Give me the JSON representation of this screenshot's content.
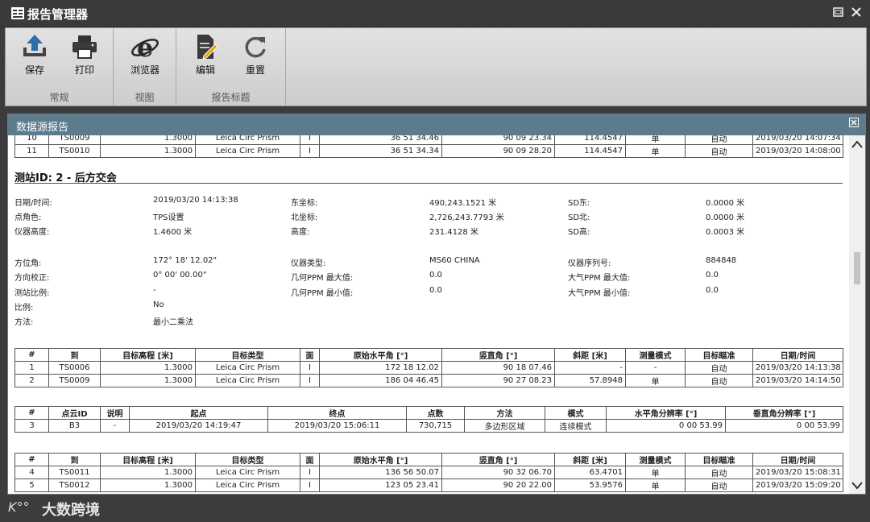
{
  "window": {
    "title": "报告管理器"
  },
  "ribbon": {
    "groups": [
      {
        "label": "常规",
        "buttons": [
          {
            "label": "保存",
            "icon": "upload-save-icon"
          },
          {
            "label": "打印",
            "icon": "printer-icon"
          }
        ]
      },
      {
        "label": "视图",
        "buttons": [
          {
            "label": "浏览器",
            "icon": "browser-e-icon"
          }
        ]
      },
      {
        "label": "报告标题",
        "buttons": [
          {
            "label": "编辑",
            "icon": "document-edit-icon"
          },
          {
            "label": "重置",
            "icon": "refresh-icon"
          }
        ]
      }
    ]
  },
  "panel": {
    "title": "数据源报告"
  },
  "top_table": {
    "rows": [
      [
        "10",
        "TS0009",
        "1.3000",
        "Leica Circ Prism",
        "I",
        "36 51 34.46",
        "90 09 23.34",
        "114.4547",
        "单",
        "自动",
        "2019/03/20 14:07:34"
      ],
      [
        "11",
        "TS0010",
        "1.3000",
        "Leica Circ Prism",
        "I",
        "36 51 34.34",
        "90 09 28.20",
        "114.4547",
        "单",
        "自动",
        "2019/03/20 14:08:00"
      ]
    ]
  },
  "station": {
    "title": "测站ID: 2 - 后方交会",
    "info_block1": {
      "col1": [
        [
          "日期/时间:",
          "2019/03/20 14:13:38"
        ],
        [
          "点角色:",
          "TPS设置"
        ],
        [
          "仪器高度:",
          "1.4600 米"
        ]
      ],
      "col2": [
        [
          "东坐标:",
          "490,243.1521 米"
        ],
        [
          "北坐标:",
          "2,726,243.7793 米"
        ],
        [
          "高度:",
          "231.4128 米"
        ]
      ],
      "col3": [
        [
          "SD东:",
          "0.0000 米"
        ],
        [
          "SD北:",
          "0.0000 米"
        ],
        [
          "SD高:",
          "0.0003 米"
        ]
      ]
    },
    "info_block2": {
      "col1": [
        [
          "方位角:",
          "172° 18' 12.02\""
        ],
        [
          "方向校正:",
          "0° 00' 00.00\""
        ],
        [
          "测站比例:",
          "-"
        ],
        [
          "比例:",
          "No"
        ],
        [
          "方法:",
          "最小二乘法"
        ]
      ],
      "col2": [
        [
          "仪器类型:",
          "MS60 CHINA"
        ],
        [
          "几何PPM 最大值:",
          "0.0"
        ],
        [
          "几何PPM 最小值:",
          "0.0"
        ]
      ],
      "col3": [
        [
          "仪器序列号:",
          "884848"
        ],
        [
          "大气PPM 最大值:",
          "0.0"
        ],
        [
          "大气PPM 最小值:",
          "0.0"
        ]
      ]
    }
  },
  "obs_table1": {
    "headers": [
      "#",
      "到",
      "目标高程 [米]",
      "目标类型",
      "面",
      "原始水平角 [°]",
      "竖直角 [°]",
      "斜距 [米]",
      "测量模式",
      "目标瞄准",
      "日期/时间"
    ],
    "rows": [
      [
        "1",
        "TS0006",
        "1.3000",
        "Leica Circ Prism",
        "I",
        "172 18 12.02",
        "90 18 07.46",
        "-",
        "-",
        "自动",
        "2019/03/20 14:13:38"
      ],
      [
        "2",
        "TS0009",
        "1.3000",
        "Leica Circ Prism",
        "I",
        "186 04 46.45",
        "90 27 08.23",
        "57.8948",
        "单",
        "自动",
        "2019/03/20 14:14:50"
      ]
    ]
  },
  "cloud_table": {
    "headers": [
      "#",
      "点云ID",
      "说明",
      "起点",
      "终点",
      "点数",
      "方法",
      "模式",
      "水平角分辨率 [°]",
      "垂直角分辨率 [°]"
    ],
    "rows": [
      [
        "3",
        "B3",
        "-",
        "2019/03/20 14:19:47",
        "2019/03/20 15:06:11",
        "730,715",
        "多边形区域",
        "连续模式",
        "0 00 53.99",
        "0 00 53.99"
      ]
    ]
  },
  "obs_table2": {
    "headers": [
      "#",
      "到",
      "目标高程 [米]",
      "目标类型",
      "面",
      "原始水平角 [°]",
      "竖直角 [°]",
      "斜距 [米]",
      "测量模式",
      "目标瞄准",
      "日期/时间"
    ],
    "rows": [
      [
        "4",
        "TS0011",
        "1.3000",
        "Leica Circ Prism",
        "I",
        "136 56 50.07",
        "90 32 06.70",
        "63.4701",
        "单",
        "自动",
        "2019/03/20 15:08:31"
      ],
      [
        "5",
        "TS0012",
        "1.3000",
        "Leica Circ Prism",
        "I",
        "123 05 23.41",
        "90 20 22.00",
        "53.9576",
        "单",
        "自动",
        "2019/03/20 15:09:20"
      ]
    ]
  },
  "footer": {
    "watermark_text": "大数跨境",
    "logo_mark": "K°°"
  }
}
